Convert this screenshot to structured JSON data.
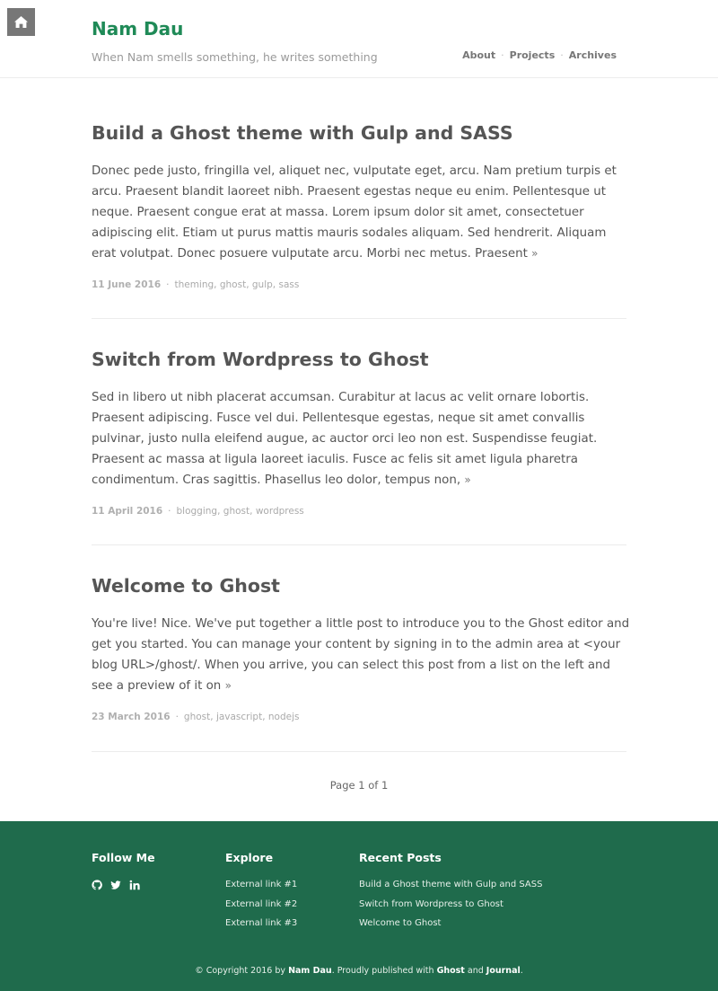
{
  "header": {
    "home_icon": "home-icon",
    "title": "Nam Dau",
    "description": "When Nam smells something, he writes something",
    "nav": [
      "About",
      "Projects",
      "Archives"
    ],
    "nav_separator": "·"
  },
  "posts": [
    {
      "title": "Build a Ghost theme with Gulp and SASS",
      "excerpt": "Donec pede justo, fringilla vel, aliquet nec, vulputate eget, arcu. Nam pretium turpis et arcu. Praesent blandit laoreet nibh. Praesent egestas neque eu enim. Pellentesque ut neque. Praesent congue erat at massa. Lorem ipsum dolor sit amet, consectetuer adipiscing elit. Etiam ut purus mattis mauris sodales aliquam. Sed hendrerit. Aliquam erat volutpat. Donec posuere vulputate arcu. Morbi nec metus. Praesent",
      "more": "»",
      "date": "11 June 2016",
      "tags": [
        "theming",
        "ghost",
        "gulp",
        "sass"
      ]
    },
    {
      "title": "Switch from Wordpress to Ghost",
      "excerpt": "Sed in libero ut nibh placerat accumsan. Curabitur at lacus ac velit ornare lobortis. Praesent adipiscing. Fusce vel dui. Pellentesque egestas, neque sit amet convallis pulvinar, justo nulla eleifend augue, ac auctor orci leo non est. Suspendisse feugiat. Praesent ac massa at ligula laoreet iaculis. Fusce ac felis sit amet ligula pharetra condimentum. Cras sagittis. Phasellus leo dolor, tempus non,",
      "more": "»",
      "date": "11 April 2016",
      "tags": [
        "blogging",
        "ghost",
        "wordpress"
      ]
    },
    {
      "title": "Welcome to Ghost",
      "excerpt": "You're live! Nice. We've put together a little post to introduce you to the Ghost editor and get you started. You can manage your content by signing in to the admin area at <your blog URL>/ghost/. When you arrive, you can select this post from a list on the left and see a preview of it on",
      "more": "»",
      "date": "23 March 2016",
      "tags": [
        "ghost",
        "javascript",
        "nodejs"
      ]
    }
  ],
  "pagination": "Page 1 of 1",
  "footer": {
    "follow_heading": "Follow Me",
    "social_icons": [
      "github-icon",
      "twitter-icon",
      "linkedin-icon"
    ],
    "explore_heading": "Explore",
    "explore_links": [
      "External link #1",
      "External link #2",
      "External link #3"
    ],
    "recent_heading": "Recent Posts",
    "recent_links": [
      "Build a Ghost theme with Gulp and SASS",
      "Switch from Wordpress to Ghost",
      "Welcome to Ghost"
    ],
    "copyright_prefix": "© Copyright 2016 by",
    "copyright_author": "Nam Dau",
    "copyright_mid": ". Proudly published with",
    "copyright_ghost": "Ghost",
    "copyright_and": "and",
    "copyright_theme": "Journal",
    "copyright_end": "."
  },
  "colors": {
    "brand": "#1f8a57",
    "footer_bg": "#1f6b4c"
  }
}
